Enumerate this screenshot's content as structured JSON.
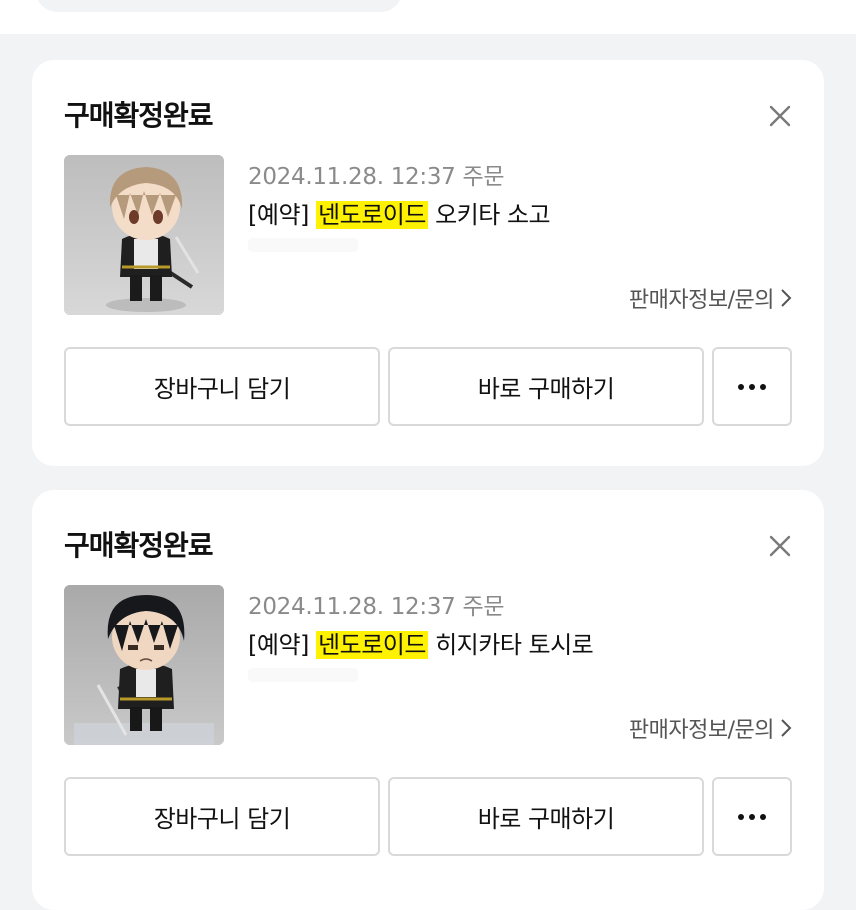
{
  "orders": [
    {
      "status": "구매확정완료",
      "order_date": "2024.11.28. 12:37 주문",
      "title_prefix": "[예약]",
      "title_highlight": "넨도로이드",
      "title_rest": "오키타 소고",
      "seller_link": "판매자정보/문의",
      "cart_button": "장바구니 담기",
      "buy_button": "바로 구매하기",
      "more_icon": "more-horizontal-icon",
      "close_icon": "close-icon"
    },
    {
      "status": "구매확정완료",
      "order_date": "2024.11.28. 12:37 주문",
      "title_prefix": "[예약]",
      "title_highlight": "넨도로이드",
      "title_rest": "히지카타 토시로",
      "seller_link": "판매자정보/문의",
      "cart_button": "장바구니 담기",
      "buy_button": "바로 구매하기",
      "more_icon": "more-horizontal-icon",
      "close_icon": "close-icon"
    }
  ],
  "colors": {
    "highlight": "#fff200",
    "background": "#f2f3f5",
    "card": "#ffffff",
    "muted_text": "#8a8a8a"
  }
}
